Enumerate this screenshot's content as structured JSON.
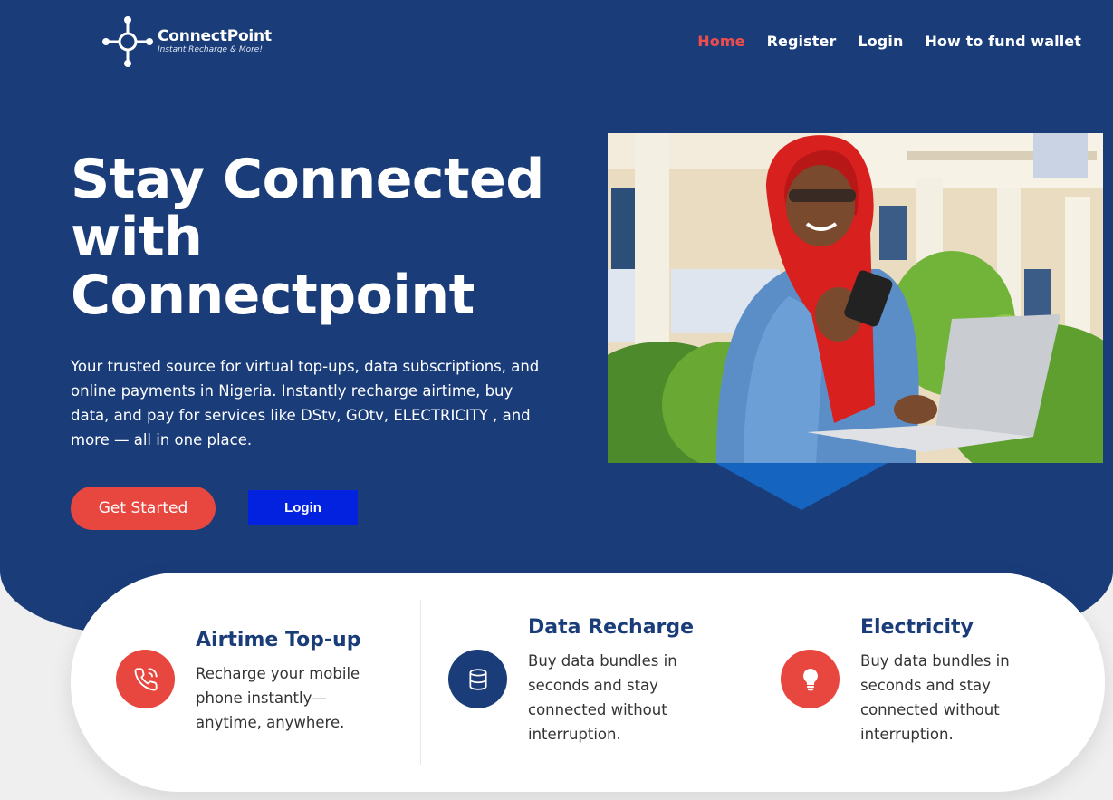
{
  "brand": {
    "name": "ConnectPoint",
    "tagline": "Instant Recharge & More!"
  },
  "nav": {
    "items": [
      {
        "label": "Home",
        "active": true
      },
      {
        "label": "Register",
        "active": false
      },
      {
        "label": "Login",
        "active": false
      },
      {
        "label": "How to fund wallet",
        "active": false
      }
    ]
  },
  "hero": {
    "headline_line1": "Stay Connected",
    "headline_line2": "with",
    "headline_line3": "Connectpoint",
    "lead": "Your trusted source for virtual top-ups, data subscriptions, and online payments in Nigeria. Instantly recharge airtime, buy data, and pay for services like DStv, GOtv, ELECTRICITY , and more — all in one place.",
    "primary_button": "Get Started",
    "secondary_button": "Login"
  },
  "services": [
    {
      "title": "Airtime Top-up",
      "description": "Recharge your mobile phone instantly—anytime, anywhere.",
      "icon": "phone-call-icon",
      "icon_color": "#e8473f"
    },
    {
      "title": "Data Recharge",
      "description": "Buy data bundles in seconds and stay connected without interruption.",
      "icon": "database-icon",
      "icon_color": "#1a3d7a"
    },
    {
      "title": "Electricity",
      "description": "Buy data bundles in seconds and stay connected without interruption.",
      "icon": "lightbulb-icon",
      "icon_color": "#e8473f"
    }
  ],
  "colors": {
    "hero_bg": "#1a3d7a",
    "accent_red": "#e8473f",
    "nav_active": "#ef4d4d",
    "login_blue": "#0222e0",
    "pointer_blue": "#1565c0"
  }
}
